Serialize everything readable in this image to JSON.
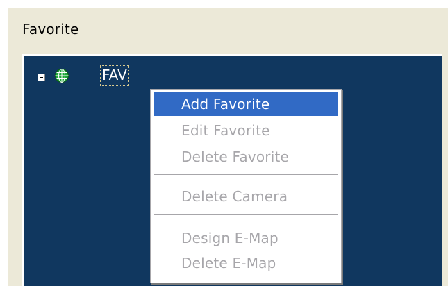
{
  "panel": {
    "title": "Favorite"
  },
  "tree": {
    "root": {
      "label": "FAV",
      "expanded": true,
      "icon": "globe-icon"
    }
  },
  "context_menu": {
    "highlight_color": "#316ac5",
    "items": [
      {
        "label": "Add Favorite",
        "enabled": true,
        "highlighted": true
      },
      {
        "label": "Edit Favorite",
        "enabled": false
      },
      {
        "label": "Delete Favorite",
        "enabled": false
      },
      {
        "label": "Delete Camera",
        "enabled": false
      },
      {
        "label": "Design E-Map",
        "enabled": false
      },
      {
        "label": "Delete E-Map",
        "enabled": false
      }
    ]
  },
  "colors": {
    "tree_background": "#10375f",
    "panel_background": "#ece9d8",
    "disabled_text": "#a7a6aa",
    "globe_green": "#1fa83a"
  }
}
